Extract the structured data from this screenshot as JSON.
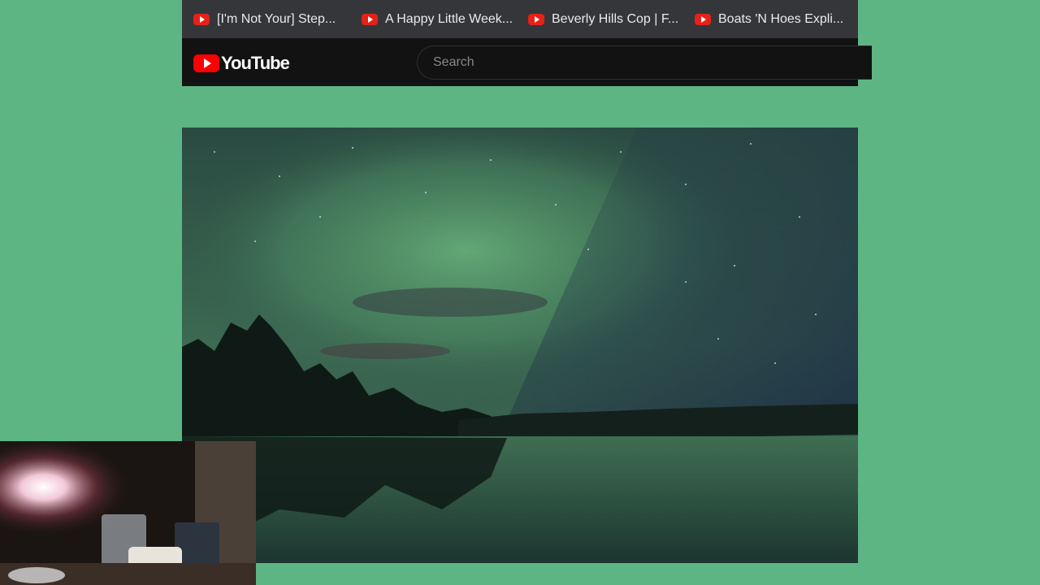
{
  "bookmarks": [
    {
      "label": "[I'm Not Your] Step...",
      "icon": "youtube-favicon"
    },
    {
      "label": "A Happy Little Week...",
      "icon": "youtube-favicon"
    },
    {
      "label": "Beverly Hills Cop | F...",
      "icon": "youtube-favicon"
    },
    {
      "label": "Boats 'N Hoes Expli...",
      "icon": "youtube-favicon"
    }
  ],
  "masthead": {
    "logo_text": "YouTube",
    "search_placeholder": "Search"
  },
  "colors": {
    "page_background": "#5db583",
    "bookmarks_bar": "#35363a",
    "masthead": "#121212",
    "youtube_red": "#ff0000"
  }
}
